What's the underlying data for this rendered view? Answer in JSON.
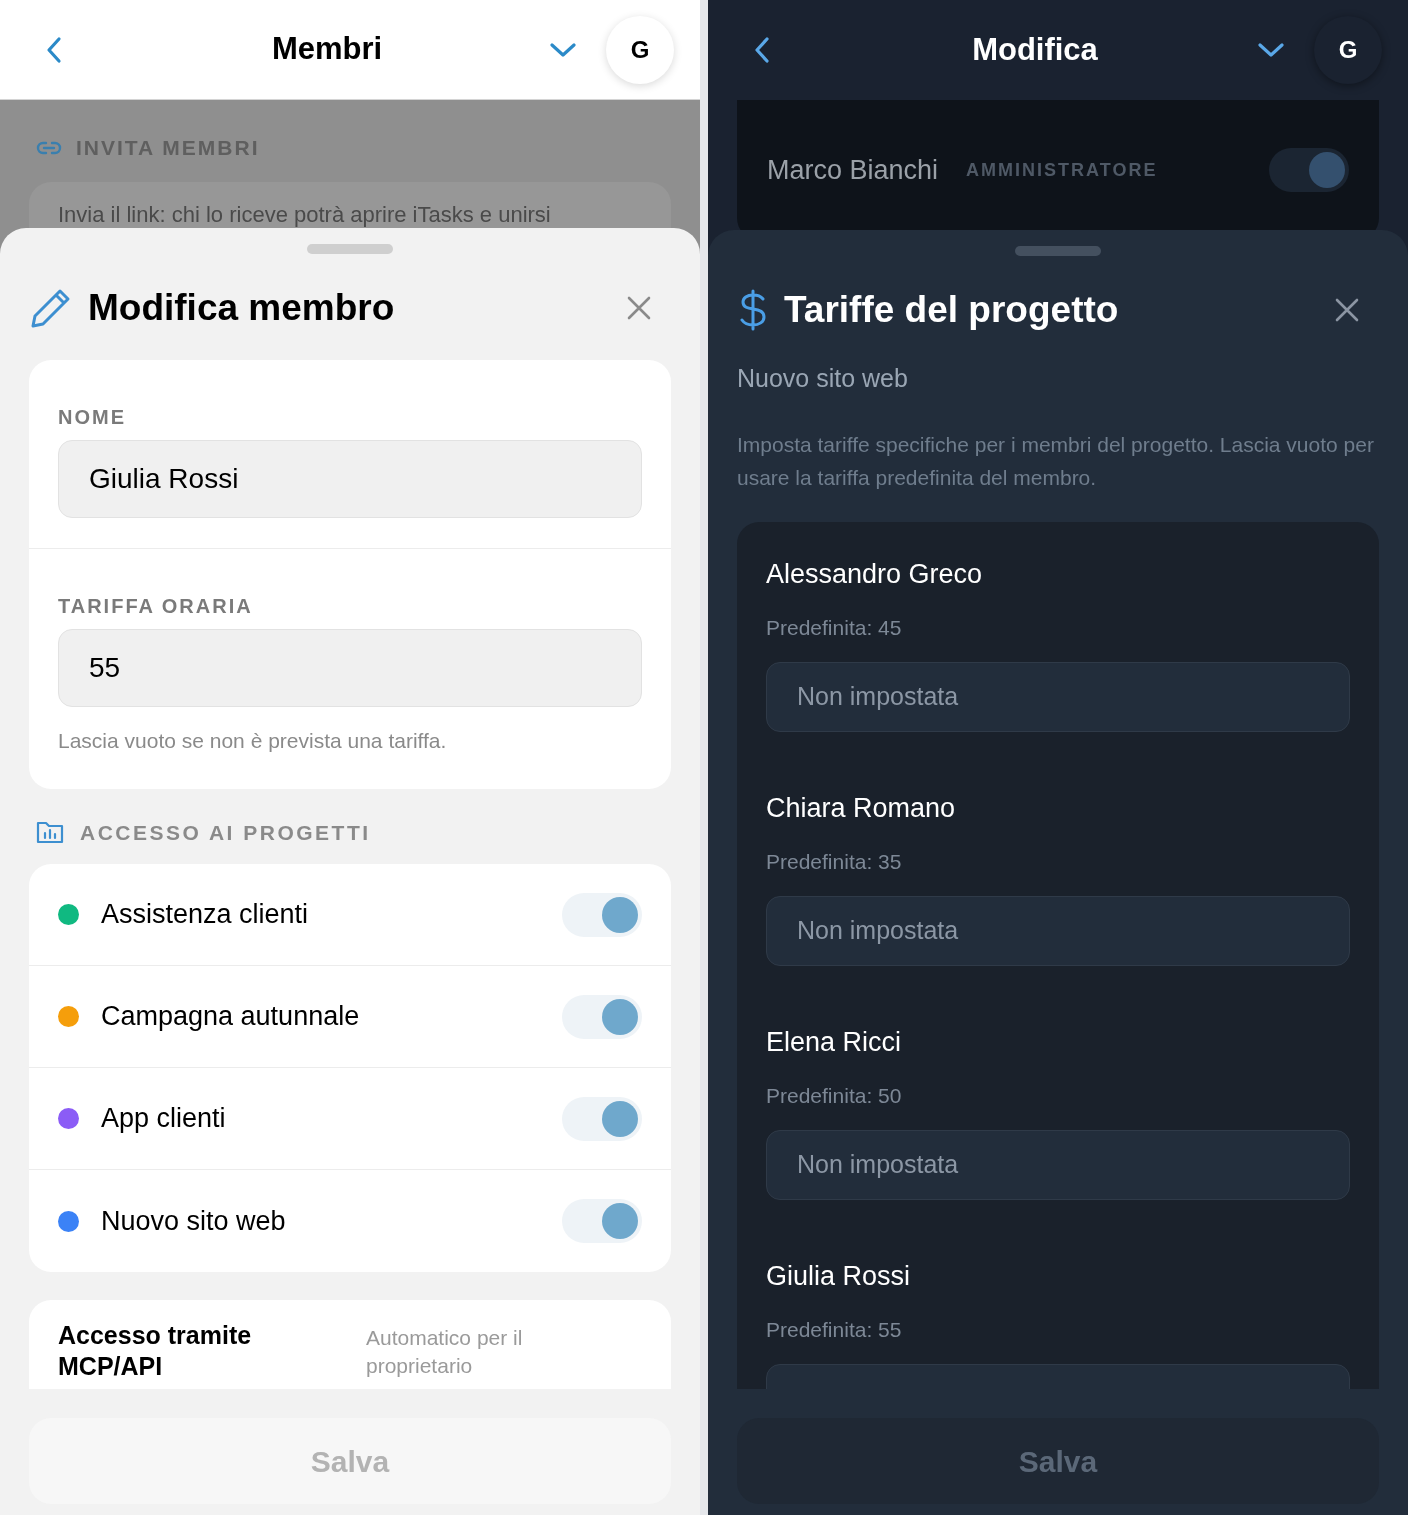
{
  "left_screen": {
    "header": {
      "title": "Membri",
      "avatar": "G"
    },
    "background": {
      "section_title": "INVITA MEMBRI",
      "text": "Invia il link: chi lo riceve potrà aprire iTasks e unirsi"
    },
    "sheet": {
      "title": "Modifica membro",
      "fields": [
        {
          "label": "NOME",
          "value": "Giulia Rossi"
        },
        {
          "label": "TARIFFA ORARIA",
          "value": "55",
          "hint": "Lascia vuoto se non è prevista una tariffa."
        }
      ],
      "section_title": "ACCESSO AI PROGETTI",
      "projects": [
        {
          "name": "Assistenza clienti",
          "color": "#10b981",
          "on": true
        },
        {
          "name": "Campagna autunnale",
          "color": "#f59e0b",
          "on": true
        },
        {
          "name": "App clienti",
          "color": "#8b5cf6",
          "on": true
        },
        {
          "name": "Nuovo sito web",
          "color": "#3b82f6",
          "on": true
        }
      ],
      "mcp": {
        "label": "Accesso tramite MCP/API",
        "value": "Automatico per il proprietario"
      },
      "save_button": {
        "label": "Salva",
        "disabled": true
      }
    }
  },
  "right_screen": {
    "header": {
      "title": "Modifica",
      "avatar": "G"
    },
    "background": {
      "members": [
        {
          "name": "Marco Bianchi",
          "role": "AMMINISTRATORE",
          "on": true
        }
      ]
    },
    "sheet": {
      "title": "Tariffe del progetto",
      "subtitle": "Nuovo sito web",
      "description": "Imposta tariffe specifiche per i membri del progetto. Lascia vuoto per usare la tariffa predefinita del membro.",
      "members": [
        {
          "name": "Alessandro Greco",
          "default": "Predefinita: 45",
          "placeholder": "Non impostata"
        },
        {
          "name": "Chiara Romano",
          "default": "Predefinita: 35",
          "placeholder": "Non impostata"
        },
        {
          "name": "Elena Ricci",
          "default": "Predefinita: 50",
          "placeholder": "Non impostata"
        },
        {
          "name": "Giulia Rossi",
          "default": "Predefinita: 55"
        }
      ],
      "save_button": {
        "label": "Salva",
        "disabled": true
      }
    }
  }
}
